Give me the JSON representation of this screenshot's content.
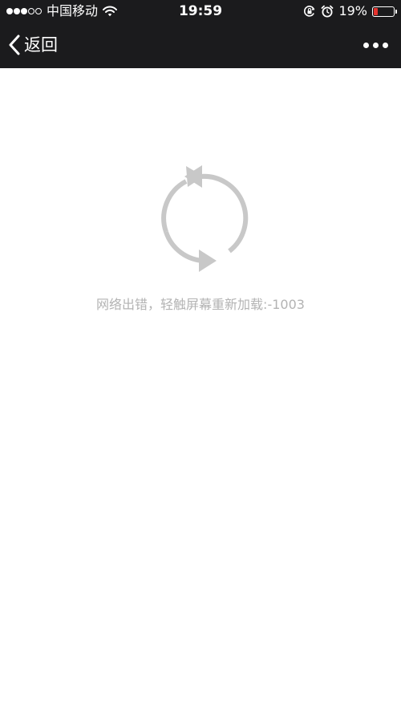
{
  "status_bar": {
    "carrier": "中国移动",
    "time": "19:59",
    "battery_percent": "19%",
    "battery_level": 0.19,
    "signal_strength": 3,
    "signal_max": 5,
    "icons": [
      "signal-dots-icon",
      "wifi-icon",
      "rotation-lock-icon",
      "alarm-clock-icon",
      "battery-icon"
    ]
  },
  "nav": {
    "back_label": "返回",
    "back_icon": "chevron-left-icon",
    "more_icon": "more-dots-icon"
  },
  "content": {
    "reload_icon": "reload-icon",
    "error_message": "网络出错，轻触屏幕重新加载:-1003"
  },
  "colors": {
    "top_bar_bg": "#1b1b1d",
    "content_bg": "#ffffff",
    "error_text": "#b3b3b3",
    "reload_icon": "#c8c8c8",
    "battery_low": "#e5322d"
  }
}
